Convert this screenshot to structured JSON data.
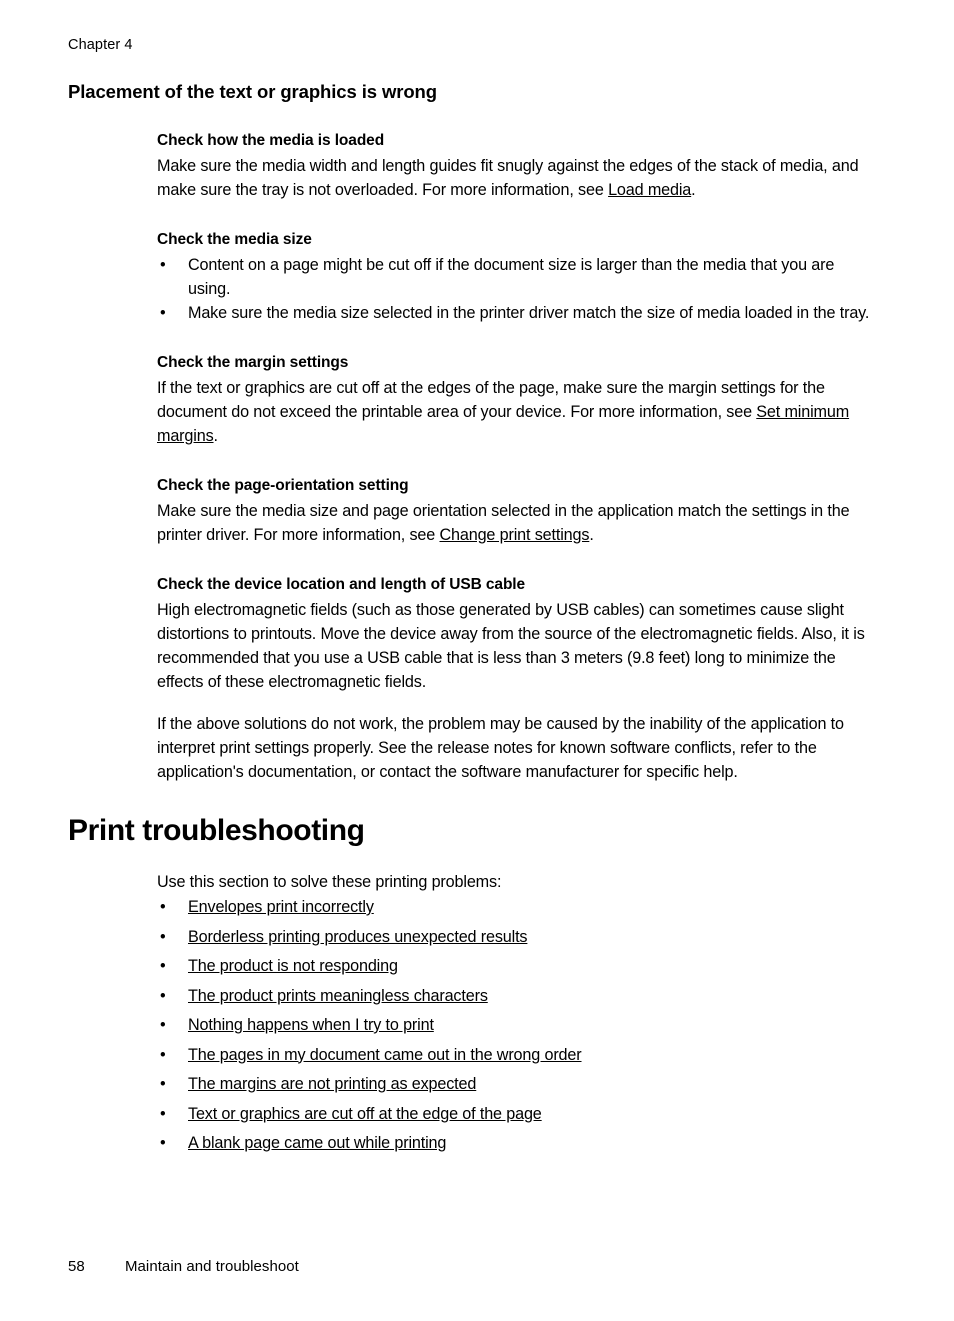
{
  "page": {
    "running_header": "Chapter 4",
    "footer": {
      "page_number": "58",
      "footer_title": "Maintain and troubleshoot"
    }
  },
  "section_placement": {
    "heading": "Placement of the text or graphics is wrong",
    "blocks": {
      "media_loaded": {
        "heading": "Check how the media is loaded",
        "paragraph_part1": "Make sure the media width and length guides fit snugly against the edges of the stack of media, and make sure the tray is not overloaded. For more information, see ",
        "link_text": "Load media",
        "paragraph_part2": "."
      },
      "media_size": {
        "heading": "Check the media size",
        "bullets": [
          "Content on a page might be cut off if the document size is larger than the media that you are using.",
          "Make sure the media size selected in the printer driver match the size of media loaded in the tray."
        ]
      },
      "margin_settings": {
        "heading": "Check the margin settings",
        "paragraph_part1": "If the text or graphics are cut off at the edges of the page, make sure the margin settings for the document do not exceed the printable area of your device. For more information, see ",
        "link_text": "Set minimum margins",
        "paragraph_part2": "."
      },
      "page_orientation": {
        "heading": "Check the page-orientation setting",
        "paragraph_part1": "Make sure the media size and page orientation selected in the application match the settings in the printer driver. For more information, see ",
        "link_text": "Change print settings",
        "paragraph_part2": "."
      },
      "usb_cable": {
        "heading": "Check the device location and length of USB cable",
        "paragraph1": "High electromagnetic fields (such as those generated by USB cables) can sometimes cause slight distortions to printouts. Move the device away from the source of the electromagnetic fields. Also, it is recommended that you use a USB cable that is less than 3 meters (9.8 feet) long to minimize the effects of these electromagnetic fields.",
        "paragraph2": "If the above solutions do not work, the problem may be caused by the inability of the application to interpret print settings properly. See the release notes for known software conflicts, refer to the application's documentation, or contact the software manufacturer for specific help."
      }
    }
  },
  "section_print_troubleshooting": {
    "heading": "Print troubleshooting",
    "lead": "Use this section to solve these printing problems:",
    "bullet_marker": "•",
    "links": [
      "Envelopes print incorrectly",
      "Borderless printing produces unexpected results",
      "The product is not responding",
      "The product prints meaningless characters",
      "Nothing happens when I try to print",
      "The pages in my document came out in the wrong order",
      "The margins are not printing as expected",
      "Text or graphics are cut off at the edge of the page",
      "A blank page came out while printing"
    ]
  },
  "colors": {
    "text": "#000000",
    "background": "#ffffff"
  }
}
